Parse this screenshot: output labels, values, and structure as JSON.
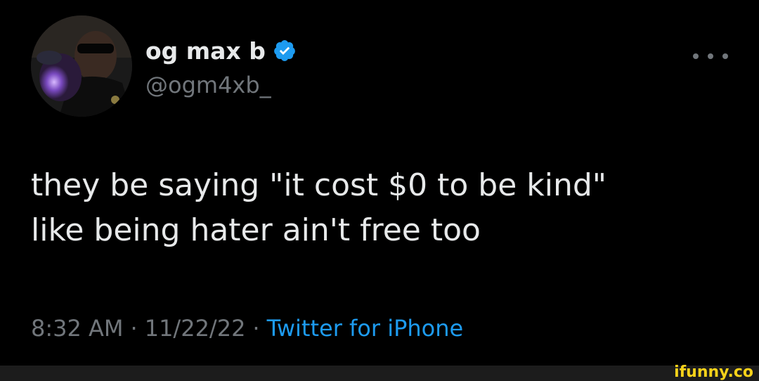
{
  "tweet": {
    "display_name": "og max b",
    "handle": "@ogm4xb_",
    "text": "they be saying \"it cost $0 to be kind\"\nlike being hater ain't free too",
    "time": "8:32 AM",
    "separator": "·",
    "date": "11/22/22",
    "source": "Twitter for iPhone"
  },
  "icons": {
    "verified": "verified-badge-icon",
    "more": "more-options-icon"
  },
  "watermark": "ifunny.co",
  "colors": {
    "background": "#000000",
    "text_primary": "#e7e9ea",
    "text_secondary": "#71767b",
    "accent": "#1d9bf0",
    "watermark": "#f7d21a"
  }
}
